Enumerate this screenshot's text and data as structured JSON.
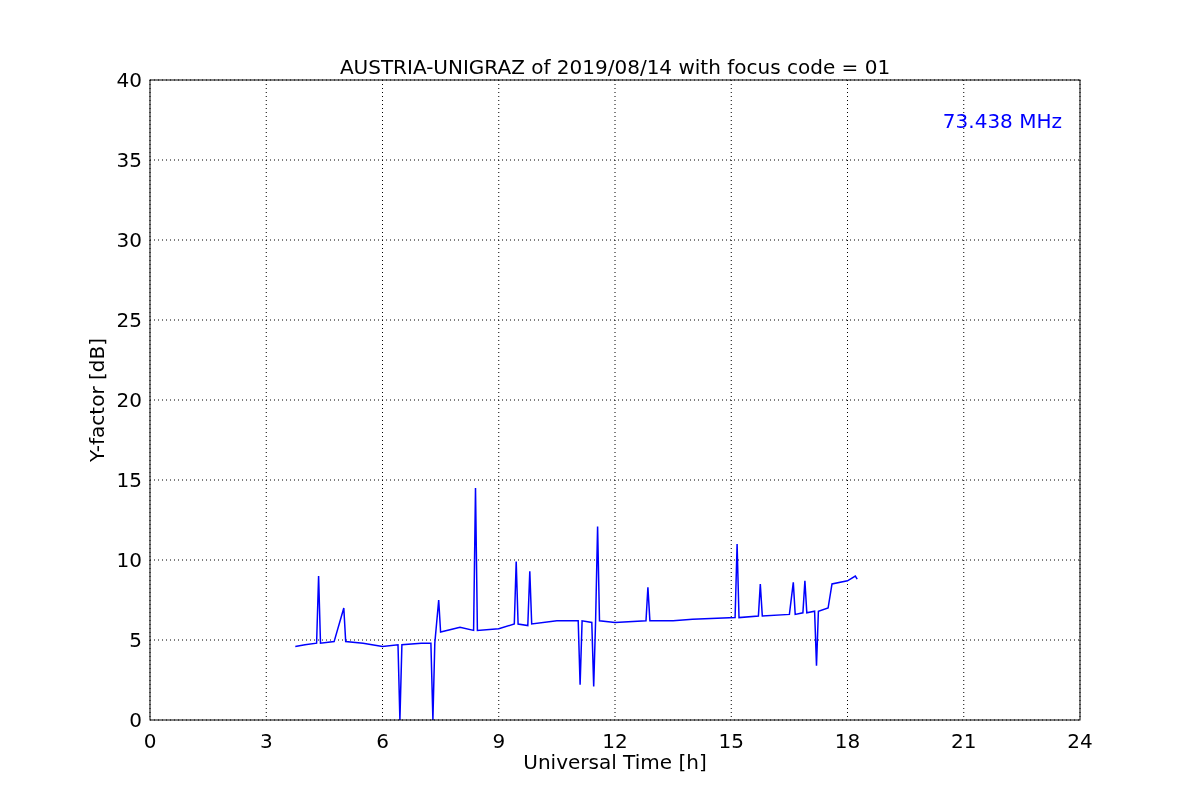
{
  "figure": {
    "chart_data": {
      "type": "line",
      "title": "AUSTRIA-UNIGRAZ of 2019/08/14 with focus code = 01",
      "xlabel": "Universal Time [h]",
      "ylabel": "Y-factor [dB]",
      "xlim": [
        0,
        24
      ],
      "ylim": [
        0,
        40
      ],
      "xticks": [
        0,
        3,
        6,
        9,
        12,
        15,
        18,
        21,
        24
      ],
      "yticks": [
        0,
        5,
        10,
        15,
        20,
        25,
        30,
        35,
        40
      ],
      "x": [
        3.75,
        4.0,
        4.3,
        4.35,
        4.4,
        4.75,
        5.0,
        5.05,
        5.5,
        6.0,
        6.4,
        6.45,
        6.5,
        7.0,
        7.25,
        7.3,
        7.35,
        7.45,
        7.5,
        8.0,
        8.35,
        8.4,
        8.45,
        9.0,
        9.4,
        9.45,
        9.5,
        9.75,
        9.8,
        9.85,
        10.5,
        11.05,
        11.1,
        11.15,
        11.4,
        11.45,
        11.5,
        11.55,
        11.6,
        12.0,
        12.8,
        12.85,
        12.9,
        13.5,
        14.0,
        15.1,
        15.15,
        15.2,
        15.7,
        15.75,
        15.8,
        16.5,
        16.6,
        16.65,
        16.85,
        16.9,
        16.95,
        17.15,
        17.2,
        17.25,
        17.5,
        17.6,
        18.0,
        18.2,
        18.25
      ],
      "series": [
        {
          "color": "#0000ff",
          "values": [
            4.6,
            4.7,
            4.8,
            9.0,
            4.8,
            4.9,
            7.0,
            4.9,
            4.8,
            4.6,
            4.7,
            0,
            4.7,
            4.8,
            4.8,
            0,
            4.8,
            7.5,
            5.5,
            5.8,
            5.6,
            14.5,
            5.6,
            5.7,
            6.0,
            9.9,
            6.0,
            5.9,
            9.3,
            6.0,
            6.2,
            6.2,
            2.2,
            6.2,
            6.1,
            2.1,
            6.2,
            12.1,
            6.2,
            6.1,
            6.2,
            8.3,
            6.2,
            6.2,
            6.3,
            6.4,
            11.0,
            6.4,
            6.5,
            8.5,
            6.5,
            6.6,
            8.6,
            6.6,
            6.7,
            8.7,
            6.7,
            6.8,
            3.4,
            6.8,
            7.0,
            8.5,
            8.7,
            9.0,
            8.8
          ]
        }
      ],
      "grid": true,
      "annotations": [
        {
          "text": "73.438 MHz"
        }
      ]
    }
  }
}
